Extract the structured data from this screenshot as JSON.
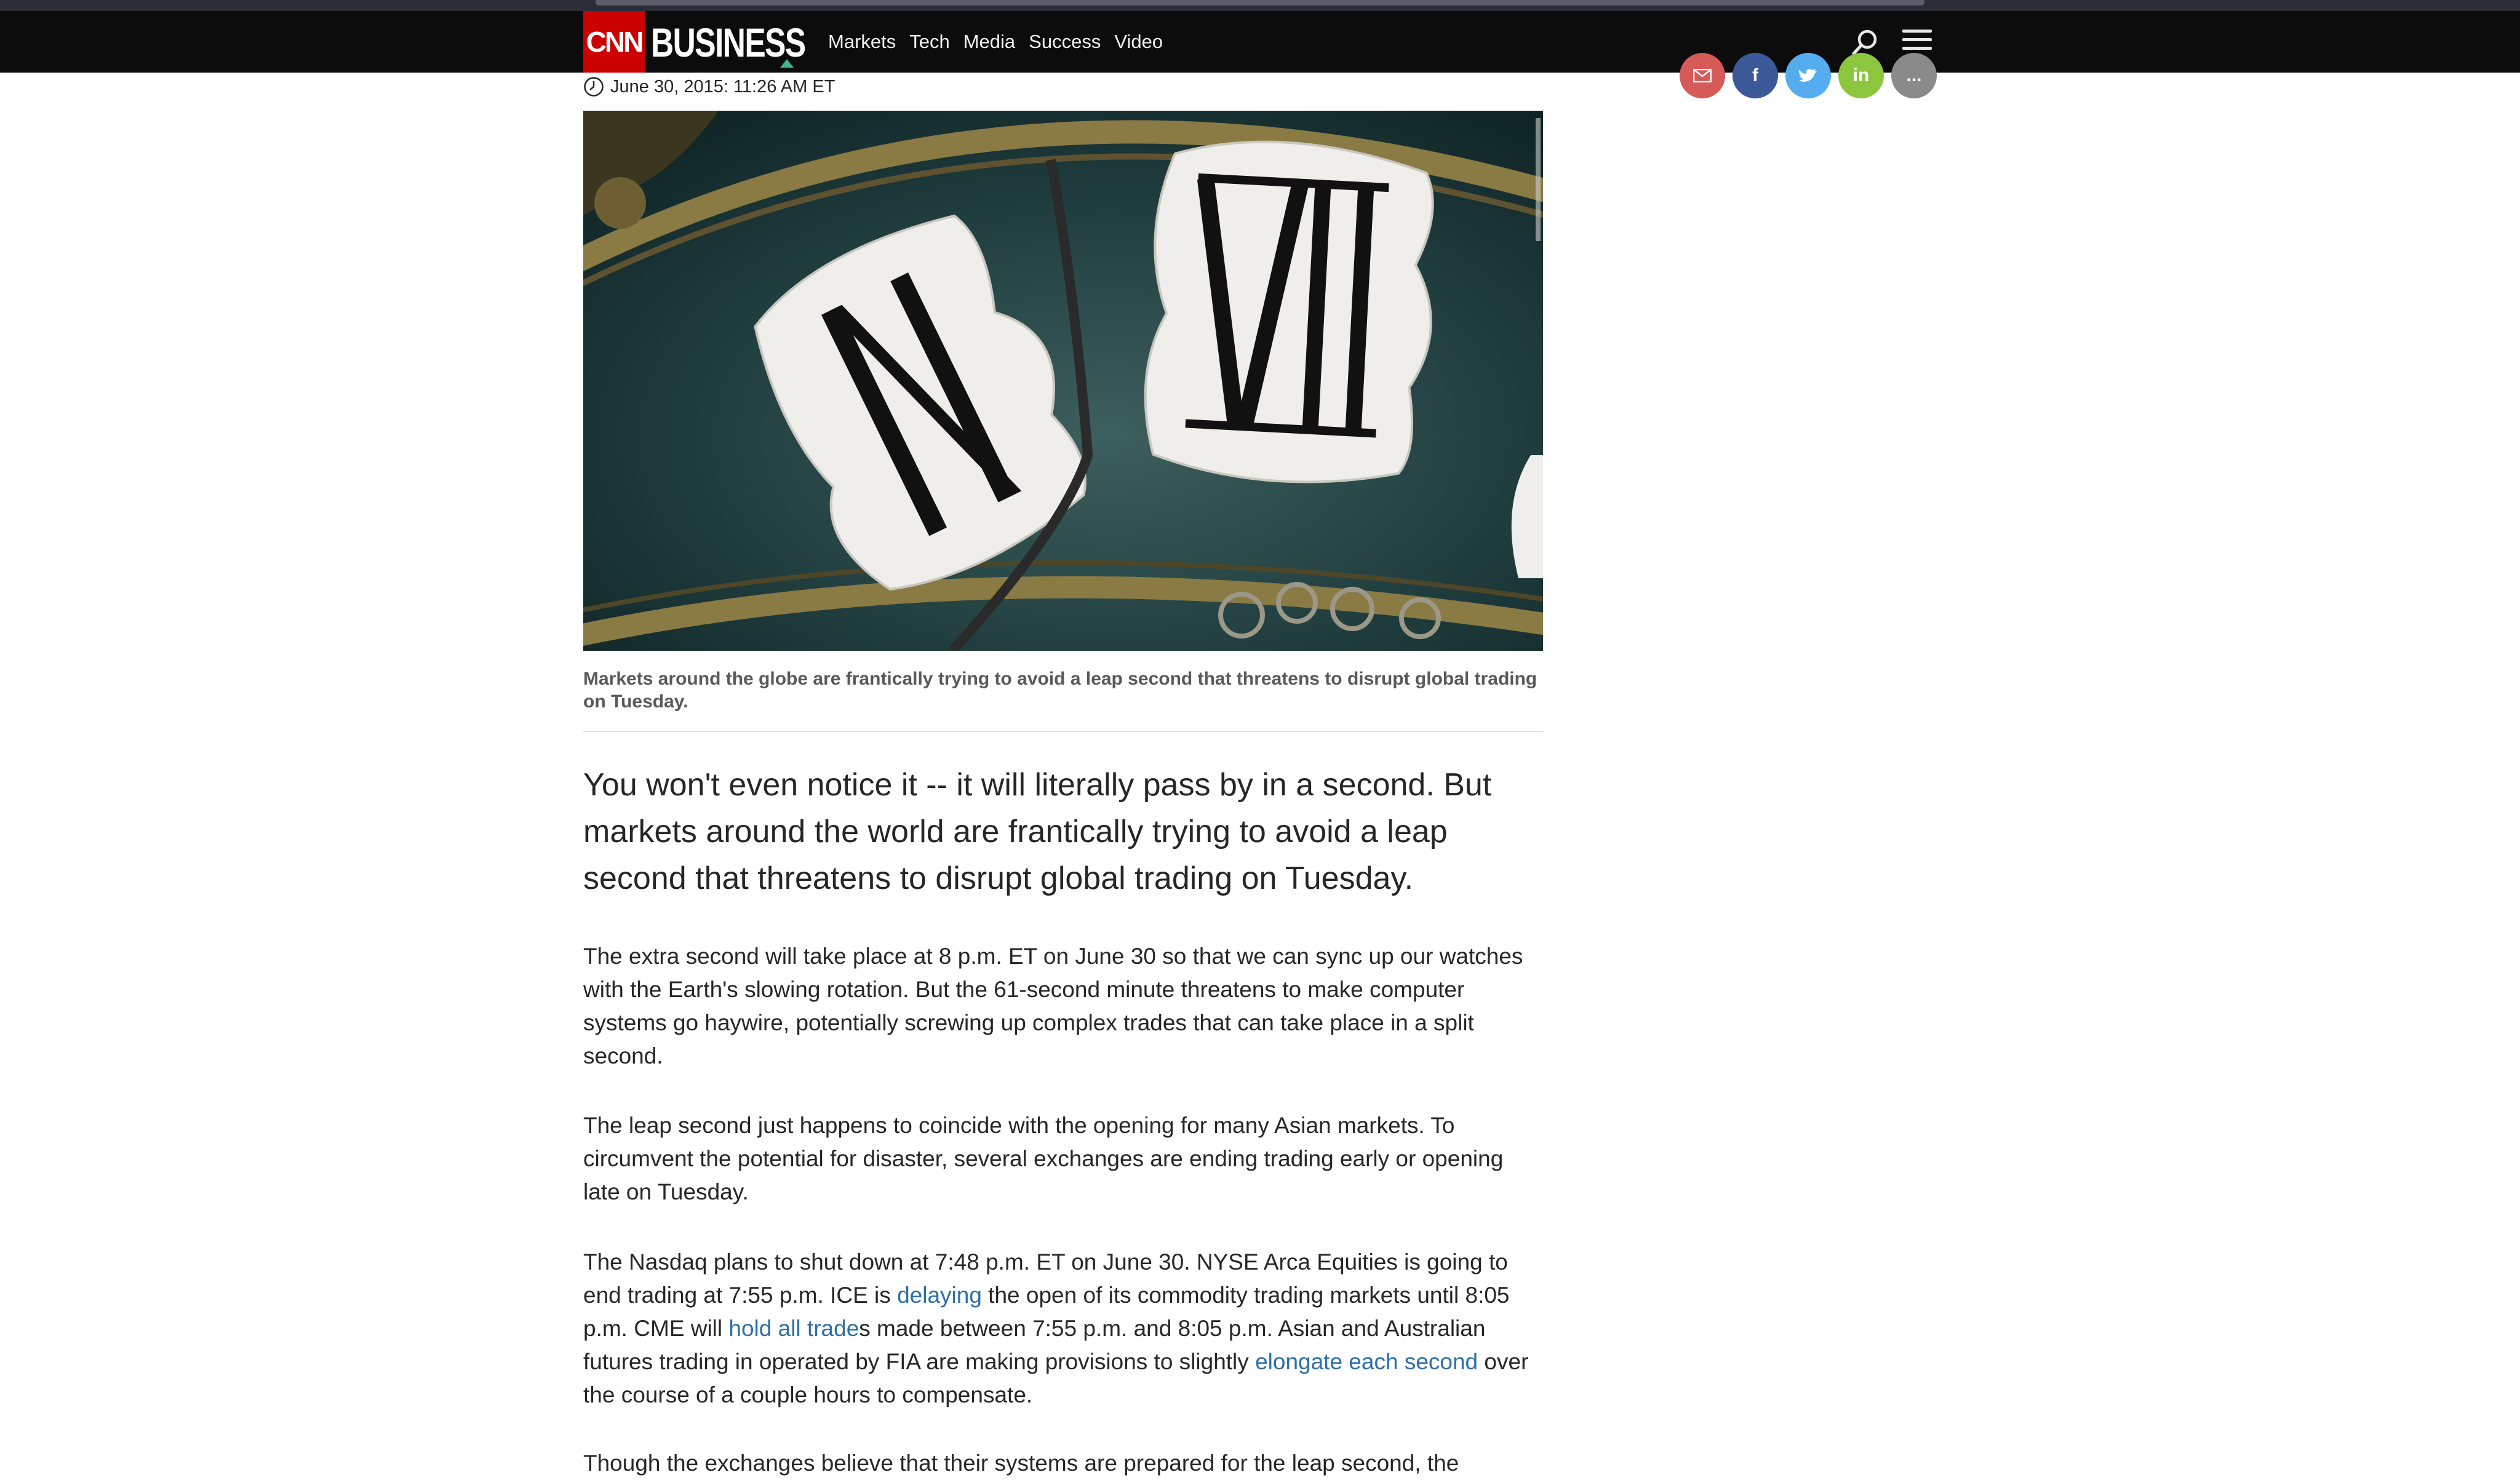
{
  "nav": {
    "logo_cnn": "CNN",
    "logo_business": "BUSINESS",
    "links": [
      "Markets",
      "Tech",
      "Media",
      "Success",
      "Video"
    ]
  },
  "social": {
    "buttons": [
      "mail",
      "f",
      "twitter",
      "in",
      "..."
    ]
  },
  "article": {
    "timestamp": "June 30, 2015: 11:26 AM ET",
    "image_overlay": "XI XII",
    "caption": "Markets around the globe are frantically trying to avoid a leap second that threatens to disrupt global trading on Tuesday.",
    "lead": "You won't even notice it -- it will literally pass by in a second. But markets around the world are frantically trying to avoid a leap second that threatens to disrupt global trading on Tuesday.",
    "p1": "The extra second will take place at 8 p.m. ET on June 30 so that we can sync up our watches with the Earth's slowing rotation. But the 61-second minute threatens to make computer systems go haywire, potentially screwing up complex trades that can take place in a split second.",
    "p2": "The leap second just happens to coincide with the opening for many Asian markets. To circumvent the potential for disaster, several exchanges are ending trading early or opening late on Tuesday.",
    "p3": {
      "t1": "The Nasdaq plans to shut down at 7:48 p.m. ET on June 30. NYSE Arca Equities is going to end trading at 7:55 p.m. ICE is ",
      "link1": "delaying",
      "t2": " the open of its commodity trading markets until 8:05 p.m. CME will ",
      "link2": "hold all trade",
      "t3": "s made between 7:55 p.m. and 8:05 p.m. Asian and Australian futures trading in operated by FIA are making provisions to slightly ",
      "link3": "elongate each second",
      "t4": " over the course of a couple hours to compensate."
    },
    "p4_partial": "Though the exchanges believe that their systems are prepared for the leap second, the"
  },
  "colors": {
    "brand_red": "#cc0000",
    "nav_bg": "#0c0c0c",
    "link": "#2d6fa9"
  }
}
